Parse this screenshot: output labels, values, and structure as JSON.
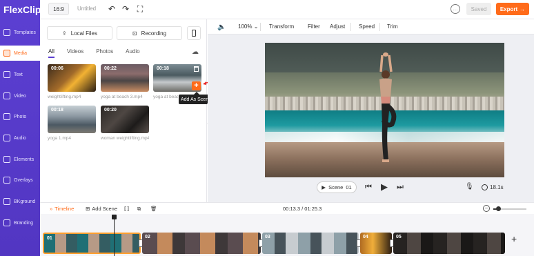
{
  "app": {
    "logo": "FlexClip",
    "ratio": "16:9",
    "title": "Untitled",
    "saved_label": "Saved",
    "export_label": "Export"
  },
  "sidebar": {
    "items": [
      {
        "label": "Templates",
        "icon": "templates-icon",
        "active": false
      },
      {
        "label": "Media",
        "icon": "media-icon",
        "active": true
      },
      {
        "label": "Text",
        "icon": "text-icon",
        "active": false
      },
      {
        "label": "Video",
        "icon": "video-icon",
        "active": false
      },
      {
        "label": "Photo",
        "icon": "photo-icon",
        "active": false
      },
      {
        "label": "Audio",
        "icon": "audio-icon",
        "active": false
      },
      {
        "label": "Elements",
        "icon": "elements-icon",
        "active": false
      },
      {
        "label": "Overlays",
        "icon": "overlays-icon",
        "active": false
      },
      {
        "label": "BKground",
        "icon": "background-icon",
        "active": false
      },
      {
        "label": "Branding",
        "icon": "branding-icon",
        "active": false
      }
    ]
  },
  "media": {
    "local_files": "Local Files",
    "recording": "Recording",
    "tabs": [
      "All",
      "Videos",
      "Photos",
      "Audio"
    ],
    "active_tab": "All",
    "items": [
      {
        "duration": "00:06",
        "name": "weightlifting.mp4"
      },
      {
        "duration": "00:22",
        "name": "yoga at beach 3.mp4"
      },
      {
        "duration": "00:18",
        "name": "yoga at beac"
      },
      {
        "duration": "00:18",
        "name": "yoga 1.mp4"
      },
      {
        "duration": "00:20",
        "name": "woman weightlifting.mp4"
      }
    ],
    "tooltip": "Add As Scene"
  },
  "editor": {
    "volume_icon": "volume-icon",
    "zoom": "100%",
    "tools": [
      "Transform",
      "Filter",
      "Adjust",
      "Speed",
      "Trim"
    ]
  },
  "player": {
    "scene_label": "Scene",
    "scene_number": "01",
    "duration": "18.1s"
  },
  "timeline": {
    "label": "Timeline",
    "add_scene": "Add Scene",
    "time": "00:13.3 / 01:25.3",
    "zoom_level": 0.15,
    "clips": [
      "01",
      "02",
      "03",
      "04",
      "05"
    ]
  },
  "colors": {
    "accent": "#ff6b1a",
    "sidebar": "#5b3fd1"
  }
}
